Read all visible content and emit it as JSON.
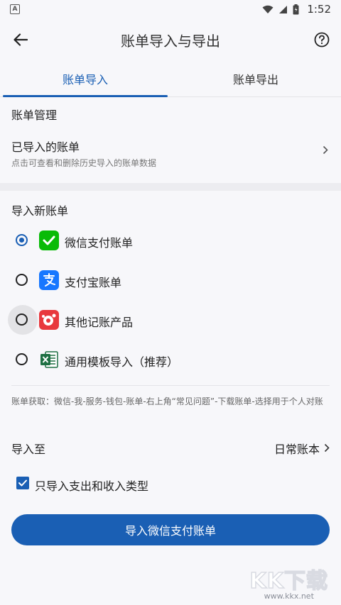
{
  "status_bar": {
    "app_badge": "A",
    "time": "1:52"
  },
  "header": {
    "title": "账单导入与导出"
  },
  "tabs": [
    {
      "label": "账单导入",
      "active": true
    },
    {
      "label": "账单导出",
      "active": false
    }
  ],
  "manage": {
    "section_title": "账单管理",
    "imported_title": "已导入的账单",
    "imported_desc": "点击可查看和删除历史导入的账单数据"
  },
  "import_new": {
    "section_title": "导入新账单",
    "options": [
      {
        "label": "微信支付账单",
        "selected": true,
        "icon": "wechat-pay-icon",
        "color": "#09bb07"
      },
      {
        "label": "支付宝账单",
        "selected": false,
        "icon": "alipay-icon",
        "color": "#1677ff"
      },
      {
        "label": "其他记账产品",
        "selected": false,
        "icon": "other-bookkeeping-icon",
        "color": "#e8383d"
      },
      {
        "label": "通用模板导入（推荐）",
        "selected": false,
        "icon": "excel-icon",
        "color": "#1d6f42"
      }
    ]
  },
  "note": "账单获取：微信-我-服务-钱包-账单-右上角“常见问题”-下载账单-选择用于个人对账",
  "import_to": {
    "label": "导入至",
    "value": "日常账本"
  },
  "checkbox": {
    "label": "只导入支出和收入类型",
    "checked": true
  },
  "primary_button": {
    "label": "导入微信支付账单"
  },
  "watermark": {
    "logo": "KK下载",
    "url": "www.kkx.net"
  },
  "colors": {
    "accent": "#1a5fb4",
    "background": "#f7f7fa"
  }
}
